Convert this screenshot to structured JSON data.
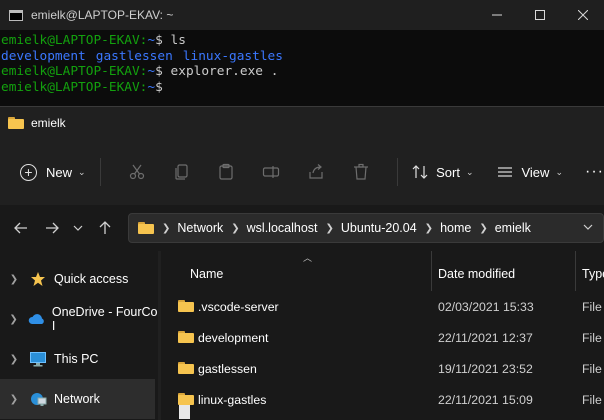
{
  "terminal": {
    "title": "emielk@LAPTOP-EKAV: ~",
    "prompt": "emielk@LAPTOP-EKAV:",
    "cwd": "~",
    "lines": [
      {
        "command": "ls"
      },
      {
        "command": "explorer.exe ."
      },
      {
        "command": ""
      }
    ],
    "ls_output": [
      "development",
      "gastlessen",
      "linux-gastles"
    ]
  },
  "explorer": {
    "title": "emielk",
    "toolbar": {
      "new_label": "New",
      "sort_label": "Sort",
      "view_label": "View",
      "more_label": "···"
    },
    "breadcrumbs": [
      "Network",
      "wsl.localhost",
      "Ubuntu-20.04",
      "home",
      "emielk"
    ],
    "nav": [
      {
        "label": "Quick access",
        "icon": "star-icon"
      },
      {
        "label": "OneDrive - FourCo I",
        "icon": "cloud-icon"
      },
      {
        "label": "This PC",
        "icon": "monitor-icon"
      },
      {
        "label": "Network",
        "icon": "network-icon"
      }
    ],
    "columns": {
      "name": "Name",
      "date": "Date modified",
      "type": "Type"
    },
    "files": [
      {
        "name": ".vscode-server",
        "date": "02/03/2021 15:33",
        "type": "File f"
      },
      {
        "name": "development",
        "date": "22/11/2021 12:37",
        "type": "File f"
      },
      {
        "name": "gastlessen",
        "date": "19/11/2021 23:52",
        "type": "File f"
      },
      {
        "name": "linux-gastles",
        "date": "22/11/2021 15:09",
        "type": "File f"
      }
    ]
  },
  "colors": {
    "prompt_green": "#13a10e",
    "dir_blue": "#3b78ff",
    "folder_yellow": "#f6c44f"
  }
}
